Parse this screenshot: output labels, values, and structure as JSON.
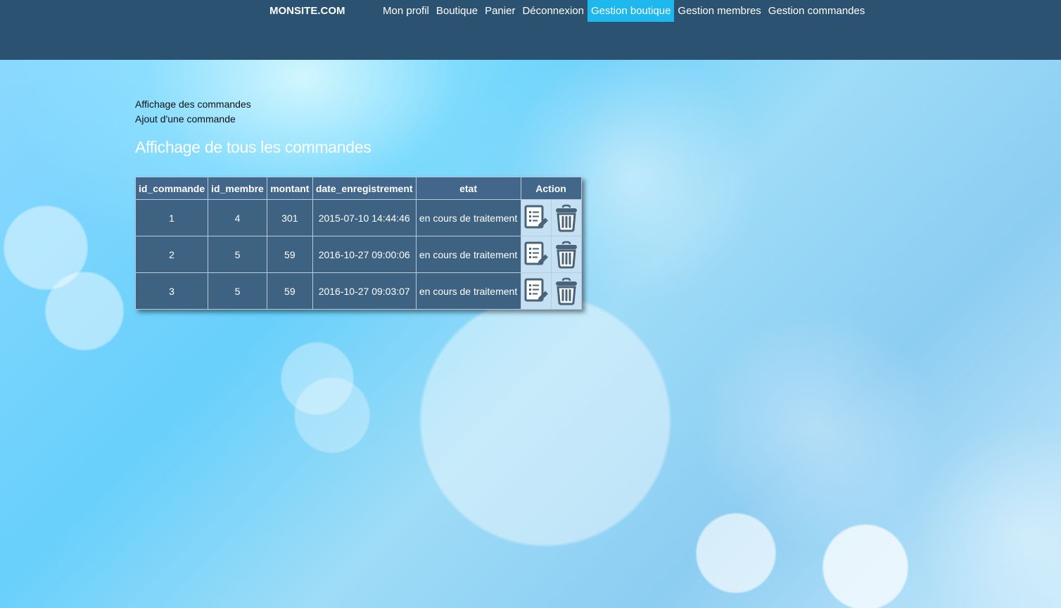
{
  "header": {
    "brand": "MONSITE.COM",
    "nav": [
      {
        "label": "Mon profil"
      },
      {
        "label": "Boutique"
      },
      {
        "label": "Panier"
      },
      {
        "label": "Déconnexion"
      },
      {
        "label": "Gestion boutique"
      },
      {
        "label": "Gestion membres"
      },
      {
        "label": "Gestion commandes"
      }
    ]
  },
  "main": {
    "links": {
      "list": "Affichage des commandes",
      "add": "Ajout d'une commande"
    },
    "title": "Affichage de tous les commandes",
    "table": {
      "headers": {
        "id_commande": "id_commande",
        "id_membre": "id_membre",
        "montant": "montant",
        "date": "date_enregistrement",
        "etat": "etat",
        "action": "Action"
      },
      "rows": [
        {
          "id_commande": "1",
          "id_membre": "4",
          "montant": "301",
          "date": "2015-07-10 14:44:46",
          "etat": "en cours de traitement"
        },
        {
          "id_commande": "2",
          "id_membre": "5",
          "montant": "59",
          "date": "2016-10-27 09:00:06",
          "etat": "en cours de traitement"
        },
        {
          "id_commande": "3",
          "id_membre": "5",
          "montant": "59",
          "date": "2016-10-27 09:03:07",
          "etat": "en cours de traitement"
        }
      ],
      "row_icons": {
        "edit": "edit-document-icon",
        "delete": "trash-icon"
      }
    }
  },
  "colors": {
    "topbar": "#2c5272",
    "nav_active": "#1eb8ee",
    "table_cell": "#3e6282",
    "action_cell": "#c5e0f3",
    "icon": "#4a6378"
  }
}
